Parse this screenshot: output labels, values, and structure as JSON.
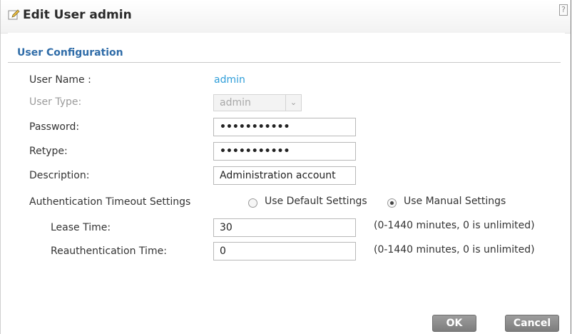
{
  "dialog": {
    "title": "Edit User admin",
    "help_icon": "?"
  },
  "section": {
    "title": "User Configuration"
  },
  "form": {
    "user_name_label": "User Name :",
    "user_name_value": "admin",
    "user_type_label": "User Type:",
    "user_type_value": "admin",
    "password_label": "Password:",
    "password_value": "•••••••••••",
    "retype_label": "Retype:",
    "retype_value": "•••••••••••",
    "description_label": "Description:",
    "description_value": "Administration account",
    "auth_timeout_label": "Authentication Timeout Settings",
    "use_default_label": "Use Default Settings",
    "use_manual_label": "Use Manual Settings",
    "selected_auth_option": "Use Manual Settings",
    "lease_time_label": "Lease Time:",
    "lease_time_value": "30",
    "lease_time_hint": "(0-1440 minutes, 0 is unlimited)",
    "reauth_time_label": "Reauthentication Time:",
    "reauth_time_value": "0",
    "reauth_time_hint": "(0-1440 minutes, 0 is unlimited)"
  },
  "buttons": {
    "ok": "OK",
    "cancel": "Cancel"
  },
  "icons": {
    "title_icon": "edit-icon",
    "help": "help-icon",
    "select_arrow": "chevron-down-icon"
  },
  "colors": {
    "section_title": "#2f6ca8",
    "link_value": "#2f9ed9",
    "button": "#8c8c8c"
  }
}
